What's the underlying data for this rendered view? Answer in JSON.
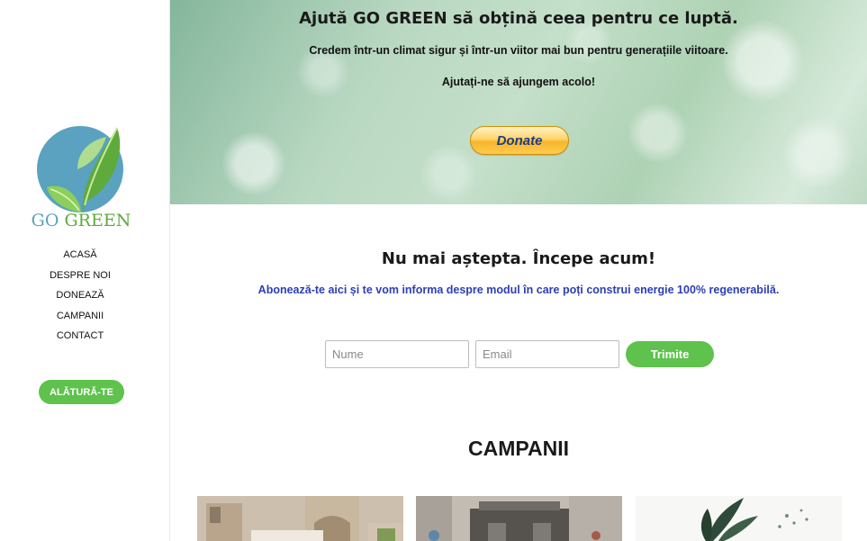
{
  "sidebar": {
    "logo": {
      "text_part1": "GO ",
      "text_part2": "GREEN",
      "icon": "leaf-globe-logo"
    },
    "nav": [
      {
        "label": "ACASĂ"
      },
      {
        "label": "DESPRE NOI"
      },
      {
        "label": "DONEAZĂ"
      },
      {
        "label": "CAMPANII"
      },
      {
        "label": "CONTACT"
      }
    ],
    "join_label": "ALĂTURĂ-TE"
  },
  "hero": {
    "title": "Ajută GO GREEN să obțină ceea pentru ce luptă.",
    "subtitle": "Credem într-un climat sigur și într-un viitor mai bun pentru generațiile viitoare.",
    "subtitle2": "Ajutați-ne să ajungem acolo!",
    "donate_label": "Donate"
  },
  "subscribe": {
    "title": "Nu mai aștepta. Începe acum!",
    "text": "Abonează-te aici și te vom informa despre modul în care poți construi energie 100% regenerabilă.",
    "name_placeholder": "Nume",
    "email_placeholder": "Email",
    "submit_label": "Trimite"
  },
  "campaigns": {
    "title": "CAMPANII"
  },
  "colors": {
    "accent_green": "#5ec24c",
    "link_blue": "#2b3fb5",
    "logo_blue": "#5aa2bf"
  }
}
